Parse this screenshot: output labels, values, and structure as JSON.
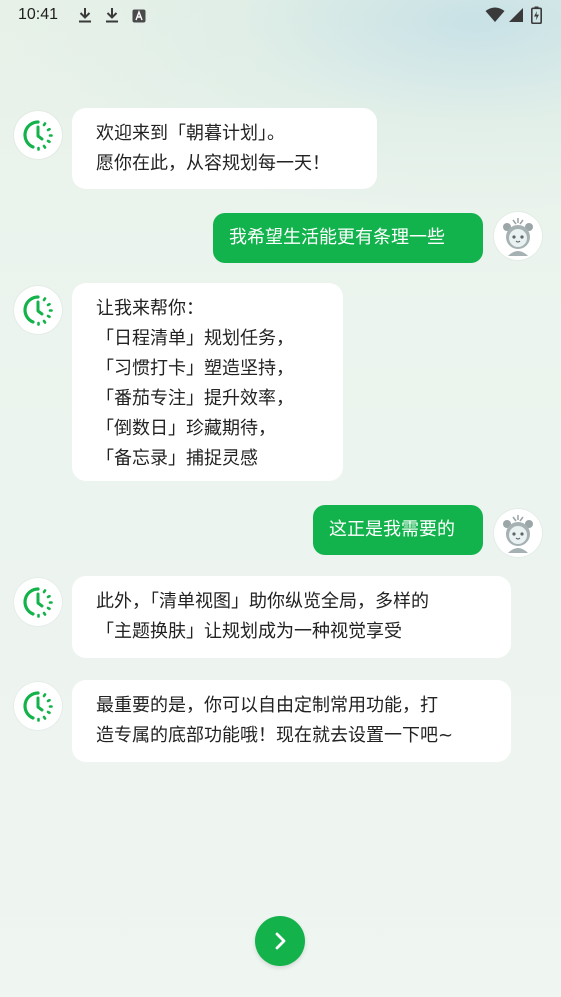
{
  "status_bar": {
    "time": "10:41",
    "notification_icons": [
      "download-icon",
      "download-icon",
      "a-letter-icon"
    ],
    "system_icons": [
      "wifi-icon",
      "cell-signal-icon",
      "battery-charging-icon"
    ]
  },
  "chat": {
    "messages": [
      {
        "sender": "bot",
        "lines": [
          "欢迎来到「朝暮计划」。",
          "愿你在此，从容规划每一天！"
        ]
      },
      {
        "sender": "user",
        "text": "我希望生活能更有条理一些"
      },
      {
        "sender": "bot",
        "lines": [
          "让我来帮你：",
          "「日程清单」规划任务，",
          "「习惯打卡」塑造坚持，",
          "「番茄专注」提升效率，",
          "「倒数日」珍藏期待，",
          "「备忘录」捕捉灵感"
        ]
      },
      {
        "sender": "user",
        "text": "这正是我需要的"
      },
      {
        "sender": "bot",
        "lines": [
          "此外，「清单视图」助你纵览全局，多样的",
          "「主题换肤」让规划成为一种视觉享受"
        ]
      },
      {
        "sender": "bot",
        "lines": [
          "最重要的是，你可以自由定制常用功能，打",
          "造专属的底部功能哦！现在就去设置一下吧~"
        ]
      }
    ]
  },
  "next_button": {
    "icon": "chevron-right-icon"
  },
  "colors": {
    "accent_green": "#13b24b",
    "bubble_white": "#ffffff",
    "background": "#ecf4ef"
  }
}
